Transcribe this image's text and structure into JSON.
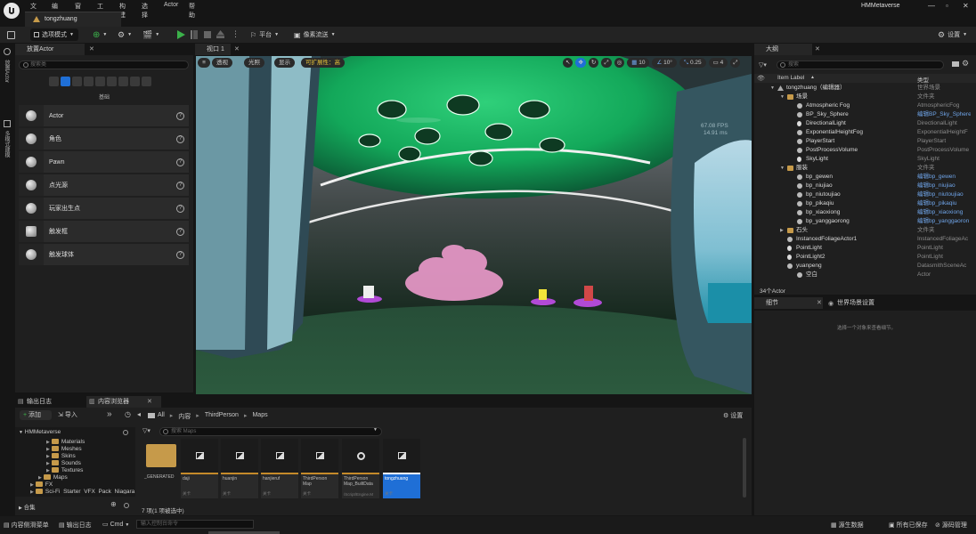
{
  "app": {
    "project": "HMMetaverse",
    "doc_tab": "tongzhuang"
  },
  "menu": [
    "文件",
    "编辑",
    "窗口",
    "工具",
    "构建",
    "选择",
    "Actor",
    "帮助"
  ],
  "toolbar": {
    "mode": "选项模式",
    "platform": "平台",
    "pixel_stream": "像素流送",
    "settings": "设置"
  },
  "side_labels": {
    "a": "放置Actor",
    "b": "多模式建模"
  },
  "place_actors": {
    "tab": "放置Actor",
    "search_placeholder": "搜索类",
    "category": "基础",
    "items": [
      {
        "label": "Actor",
        "icon": "actor-sphere-icon"
      },
      {
        "label": "角色",
        "icon": "character-icon"
      },
      {
        "label": "Pawn",
        "icon": "pawn-icon"
      },
      {
        "label": "点光源",
        "icon": "point-light-icon"
      },
      {
        "label": "玩家出生点",
        "icon": "player-start-icon"
      },
      {
        "label": "触发框",
        "icon": "trigger-box-icon"
      },
      {
        "label": "触发球体",
        "icon": "trigger-sphere-icon"
      }
    ]
  },
  "viewport": {
    "tab": "视口 1",
    "perspective": "透视",
    "lit": "光照",
    "show": "显示",
    "scalability": "可扩展性：高",
    "fps": "67.08 FPS",
    "ms": "14.91 ms",
    "grid": "10",
    "angle": "10°",
    "scale": "0.25",
    "camera_speed": "4"
  },
  "outliner": {
    "tab": "大纲",
    "search_placeholder": "搜索",
    "col_label": "Item Label",
    "col_type": "类型",
    "rows": [
      {
        "name": "tongzhuang（编辑器）",
        "type": "世界场景",
        "indent": 0,
        "kind": "world"
      },
      {
        "name": "场景",
        "type": "文件夹",
        "indent": 1,
        "kind": "folder"
      },
      {
        "name": "Atmospheric Fog",
        "type": "AtmosphericFog",
        "indent": 2,
        "kind": "actor"
      },
      {
        "name": "BP_Sky_Sphere",
        "type": "编辑BP_Sky_Sphere",
        "indent": 2,
        "kind": "actor",
        "link": true
      },
      {
        "name": "DirectionalLight",
        "type": "DirectionalLight",
        "indent": 2,
        "kind": "light"
      },
      {
        "name": "ExponentialHeightFog",
        "type": "ExponentialHeightF",
        "indent": 2,
        "kind": "actor"
      },
      {
        "name": "PlayerStart",
        "type": "PlayerStart",
        "indent": 2,
        "kind": "actor"
      },
      {
        "name": "PostProcessVolume",
        "type": "PostProcessVolume",
        "indent": 2,
        "kind": "actor"
      },
      {
        "name": "SkyLight",
        "type": "SkyLight",
        "indent": 2,
        "kind": "light"
      },
      {
        "name": "服装",
        "type": "文件夹",
        "indent": 1,
        "kind": "folder"
      },
      {
        "name": "bp_gewen",
        "type": "编辑bp_gewen",
        "indent": 2,
        "kind": "actor",
        "link": true
      },
      {
        "name": "bp_niujiao",
        "type": "编辑bp_niujiao",
        "indent": 2,
        "kind": "actor",
        "link": true
      },
      {
        "name": "bp_niutoujiao",
        "type": "编辑bp_niutoujiao",
        "indent": 2,
        "kind": "actor",
        "link": true
      },
      {
        "name": "bp_pikaqiu",
        "type": "编辑bp_pikaqiu",
        "indent": 2,
        "kind": "actor",
        "link": true
      },
      {
        "name": "bp_xiaoxiong",
        "type": "编辑bp_xiaoxiong",
        "indent": 2,
        "kind": "actor",
        "link": true
      },
      {
        "name": "bp_yanggaorong",
        "type": "编辑bp_yanggaoron",
        "indent": 2,
        "kind": "actor",
        "link": true
      },
      {
        "name": "石头",
        "type": "文件夹",
        "indent": 1,
        "kind": "folder"
      },
      {
        "name": "InstancedFoliageActor1",
        "type": "InstancedFoliageAc",
        "indent": 1,
        "kind": "actor"
      },
      {
        "name": "PointLight",
        "type": "PointLight",
        "indent": 1,
        "kind": "light"
      },
      {
        "name": "PointLight2",
        "type": "PointLight",
        "indent": 1,
        "kind": "light"
      },
      {
        "name": "yuanpeng",
        "type": "DatasmithSceneAc",
        "indent": 1,
        "kind": "actor"
      },
      {
        "name": "空白",
        "type": "Actor",
        "indent": 2,
        "kind": "actor"
      }
    ],
    "count": "34个Actor"
  },
  "details": {
    "tab": "细节",
    "tab2": "世界场景设置",
    "empty": "选择一个对象来查看细节。"
  },
  "bottom_tabs": {
    "output": "输出日志",
    "content": "内容浏览器"
  },
  "content_browser": {
    "add": "添加",
    "import": "导入",
    "path": [
      "All",
      "内容",
      "ThirdPerson",
      "Maps"
    ],
    "settings": "设置",
    "search_placeholder": "搜索 Maps",
    "root": "HMMetaverse",
    "tree": [
      {
        "name": "Materials",
        "indent": 3
      },
      {
        "name": "Meshes",
        "indent": 3
      },
      {
        "name": "Skins",
        "indent": 3
      },
      {
        "name": "Sounds",
        "indent": 3
      },
      {
        "name": "Textures",
        "indent": 3
      },
      {
        "name": "Maps",
        "indent": 2
      },
      {
        "name": "FX",
        "indent": 1
      },
      {
        "name": "Sci-Fi_Starter_VFX_Pack_Niagara",
        "indent": 1
      }
    ],
    "collections": "合集",
    "assets": [
      {
        "name": "_GENERATED",
        "type": "",
        "kind": "folder"
      },
      {
        "name": "daji",
        "type": "关卡",
        "kind": "map"
      },
      {
        "name": "huanjin",
        "type": "关卡",
        "kind": "map"
      },
      {
        "name": "hanjieruf",
        "type": "关卡",
        "kind": "map"
      },
      {
        "name": "ThirdPerson Map",
        "type": "关卡",
        "kind": "map"
      },
      {
        "name": "ThirdPerson Map_BuiltData",
        "type": "/Script/Engine.M",
        "kind": "data"
      },
      {
        "name": "tongzhuang",
        "type": "关卡",
        "kind": "map",
        "selected": true
      }
    ],
    "status": "7 项(1 项被选中)"
  },
  "statusbar": {
    "drawer": "内容侧滑菜单",
    "output": "输出日志",
    "cmd": "Cmd",
    "console_placeholder": "输入控制台命令",
    "source_control_label": "源生数据",
    "save_all": "所有已保存",
    "source_mgmt": "源码管理"
  },
  "colors": {
    "accent": "#1f6fd6",
    "folder": "#c69a4a",
    "play": "#3bb14a",
    "link": "#6fa4e8"
  }
}
